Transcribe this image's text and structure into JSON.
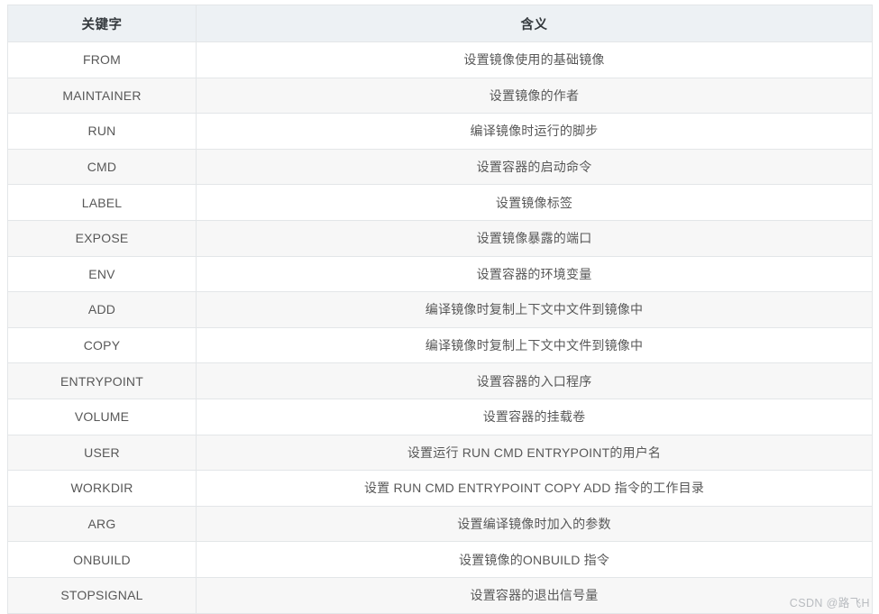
{
  "table": {
    "columns": [
      "关键字",
      "含义"
    ],
    "rows": [
      {
        "keyword": "FROM",
        "meaning": "设置镜像使用的基础镜像"
      },
      {
        "keyword": "MAINTAINER",
        "meaning": "设置镜像的作者"
      },
      {
        "keyword": "RUN",
        "meaning": "编译镜像时运行的脚步"
      },
      {
        "keyword": "CMD",
        "meaning": "设置容器的启动命令"
      },
      {
        "keyword": "LABEL",
        "meaning": "设置镜像标签"
      },
      {
        "keyword": "EXPOSE",
        "meaning": "设置镜像暴露的端口"
      },
      {
        "keyword": "ENV",
        "meaning": "设置容器的环境变量"
      },
      {
        "keyword": "ADD",
        "meaning": "编译镜像时复制上下文中文件到镜像中"
      },
      {
        "keyword": "COPY",
        "meaning": "编译镜像时复制上下文中文件到镜像中"
      },
      {
        "keyword": "ENTRYPOINT",
        "meaning": "设置容器的入口程序"
      },
      {
        "keyword": "VOLUME",
        "meaning": "设置容器的挂载卷"
      },
      {
        "keyword": "USER",
        "meaning": "设置运行 RUN CMD ENTRYPOINT的用户名"
      },
      {
        "keyword": "WORKDIR",
        "meaning": "设置 RUN CMD ENTRYPOINT COPY ADD 指令的工作目录"
      },
      {
        "keyword": "ARG",
        "meaning": "设置编译镜像时加入的参数"
      },
      {
        "keyword": "ONBUILD",
        "meaning": "设置镜像的ONBUILD 指令"
      },
      {
        "keyword": "STOPSIGNAL",
        "meaning": "设置容器的退出信号量"
      }
    ]
  },
  "watermark": {
    "text": "CSDN @路飞H"
  },
  "colors": {
    "header_background": "#edf1f4",
    "header_text": "#34393d",
    "row_odd_background": "#ffffff",
    "row_even_background": "#f7f7f7",
    "body_text": "#585858",
    "border": "#e3e6e8",
    "watermark_text": "#b9bcc0"
  }
}
